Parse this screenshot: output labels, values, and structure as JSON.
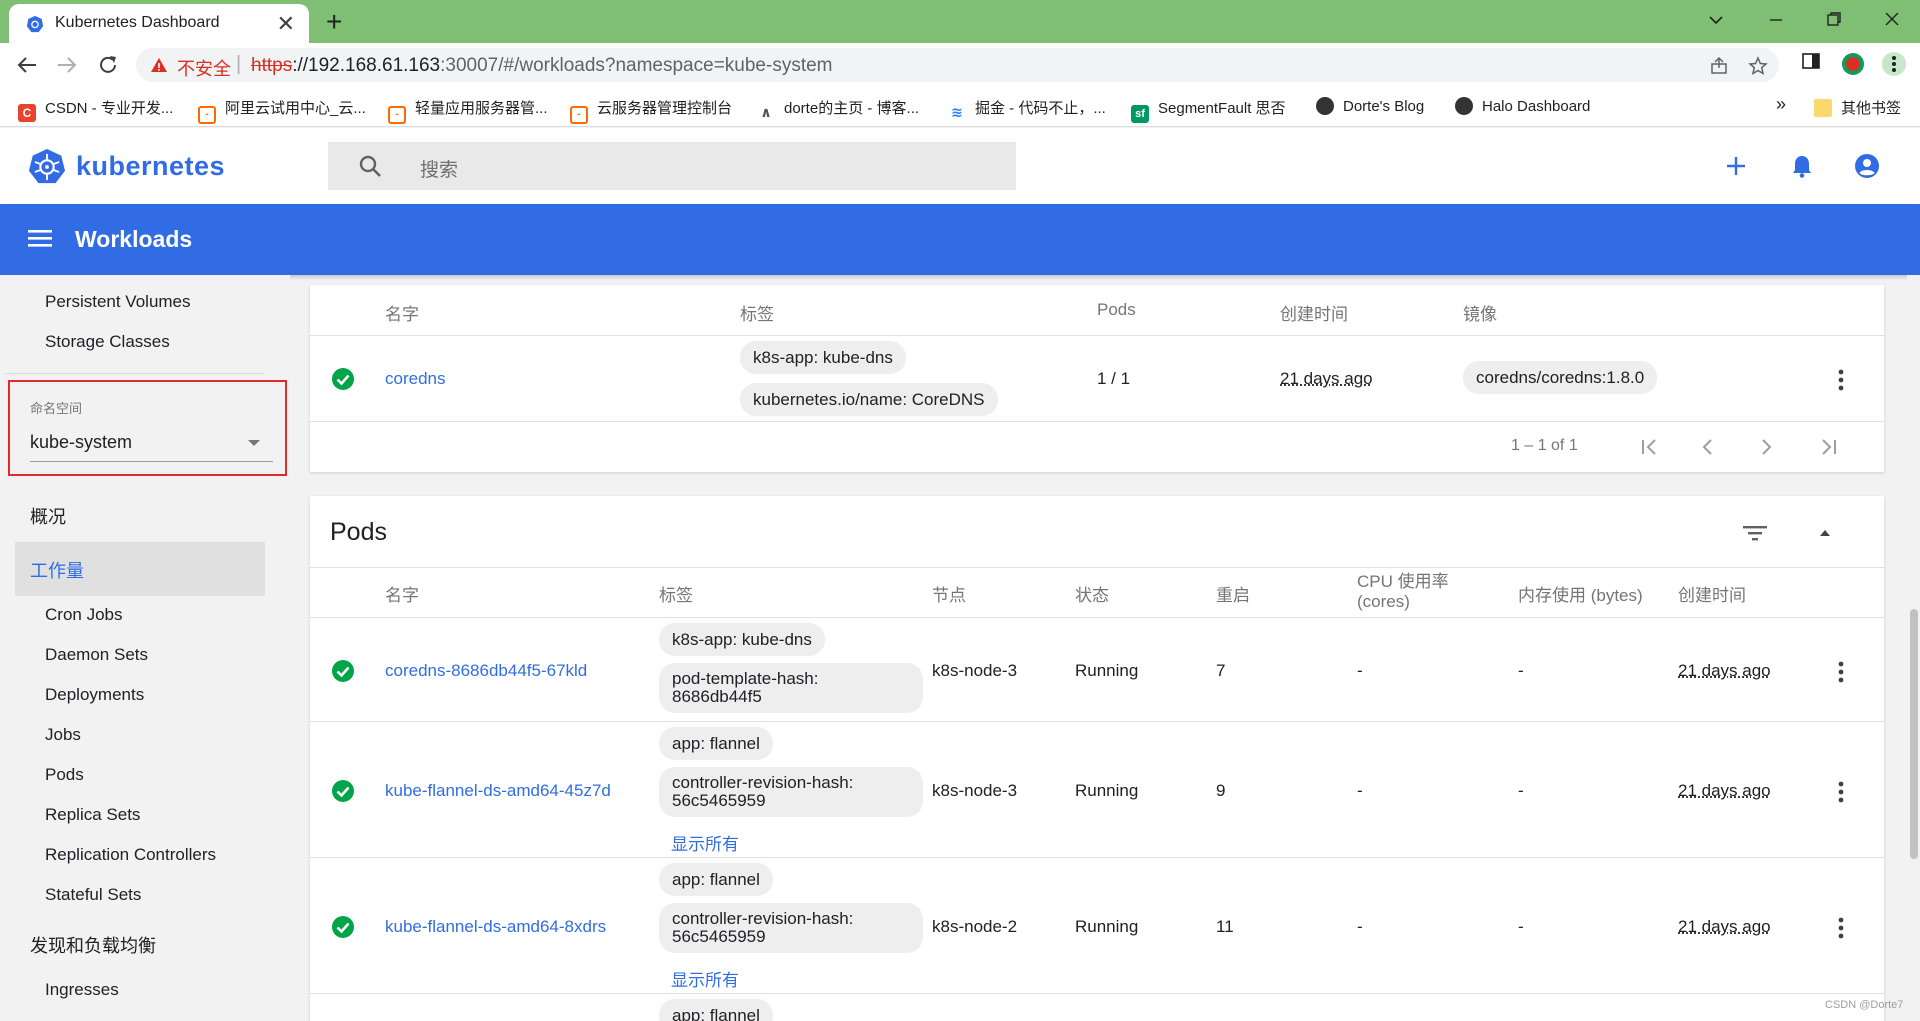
{
  "browser": {
    "tab_title": "Kubernetes Dashboard",
    "tab_close": "✕",
    "new_tab": "+",
    "insecure_label": "不安全",
    "url_scheme": "https",
    "url_host": "://192.168.61.163",
    "url_path": ":30007/#/workloads?namespace=kube-system",
    "bookmarks": [
      {
        "label": "CSDN - 专业开发...",
        "icon_color": "#e8432e",
        "icon_char": "C"
      },
      {
        "label": "阿里云试用中心_云...",
        "icon_color": "#ff6a00",
        "icon_char": "[-]"
      },
      {
        "label": "轻量应用服务器管...",
        "icon_color": "#ff6a00",
        "icon_char": "[-]"
      },
      {
        "label": "云服务器管理控制台",
        "icon_color": "#ff6a00",
        "icon_char": "[-]"
      },
      {
        "label": "dorte的主页 - 博客...",
        "icon_color": "#555555",
        "icon_char": "𝓐"
      },
      {
        "label": "掘金 - 代码不止，...",
        "icon_color": "#1e80ff",
        "icon_char": "≋"
      },
      {
        "label": "SegmentFault 思否",
        "icon_color": "#009a61",
        "icon_char": "sf"
      },
      {
        "label": "Dorte's Blog",
        "icon_color": "#333333",
        "icon_char": "◉"
      },
      {
        "label": "Halo Dashboard",
        "icon_color": "#333333",
        "icon_char": "◉"
      }
    ],
    "bookmarks_more": "»",
    "other_bookmarks": "其他书签"
  },
  "header": {
    "logo_text": "kubernetes",
    "search_placeholder": "搜索"
  },
  "toolbar": {
    "title": "Workloads"
  },
  "sidebar": {
    "storage_items": [
      "Persistent Volumes",
      "Storage Classes"
    ],
    "namespace_label": "命名空间",
    "namespace_value": "kube-system",
    "overview": "概况",
    "workloads": "工作量",
    "workload_items": [
      "Cron Jobs",
      "Daemon Sets",
      "Deployments",
      "Jobs",
      "Pods",
      "Replica Sets",
      "Replication Controllers",
      "Stateful Sets"
    ],
    "discovery": "发现和负载均衡",
    "discovery_items": [
      "Ingresses"
    ]
  },
  "deployments": {
    "columns": [
      "名字",
      "标签",
      "Pods",
      "创建时间",
      "镜像"
    ],
    "rows": [
      {
        "name": "coredns",
        "labels": [
          "k8s-app: kube-dns",
          "kubernetes.io/name: CoreDNS"
        ],
        "pods": "1 / 1",
        "created": "21 days ago",
        "image": "coredns/coredns:1.8.0"
      }
    ],
    "pager_text": "1 – 1 of 1"
  },
  "pods": {
    "title": "Pods",
    "columns": [
      "名字",
      "标签",
      "节点",
      "状态",
      "重启",
      "CPU 使用率 (cores)",
      "内存使用 (bytes)",
      "创建时间"
    ],
    "rows": [
      {
        "name": "coredns-8686db44f5-67kld",
        "labels": [
          "k8s-app: kube-dns",
          "pod-template-hash: 8686db44f5"
        ],
        "show_all": "",
        "node": "k8s-node-3",
        "status": "Running",
        "restarts": "7",
        "cpu": "-",
        "memory": "-",
        "created": "21 days ago"
      },
      {
        "name": "kube-flannel-ds-amd64-45z7d",
        "labels": [
          "app: flannel",
          "controller-revision-hash: 56c5465959"
        ],
        "show_all": "显示所有",
        "node": "k8s-node-3",
        "status": "Running",
        "restarts": "9",
        "cpu": "-",
        "memory": "-",
        "created": "21 days ago"
      },
      {
        "name": "kube-flannel-ds-amd64-8xdrs",
        "labels": [
          "app: flannel",
          "controller-revision-hash: 56c5465959"
        ],
        "show_all": "显示所有",
        "node": "k8s-node-2",
        "status": "Running",
        "restarts": "11",
        "cpu": "-",
        "memory": "-",
        "created": "21 days ago"
      },
      {
        "name": "",
        "labels": [
          "app: flannel"
        ],
        "show_all": "",
        "node": "",
        "status": "",
        "restarts": "",
        "cpu": "",
        "memory": "",
        "created": ""
      }
    ]
  },
  "watermark": "CSDN @Dorte7",
  "colors": {
    "brand": "#326ce5",
    "success": "#00a54a",
    "insecure": "#d93025",
    "highlight_box": "#e02b2b",
    "tabbar": "#7fbf73"
  }
}
